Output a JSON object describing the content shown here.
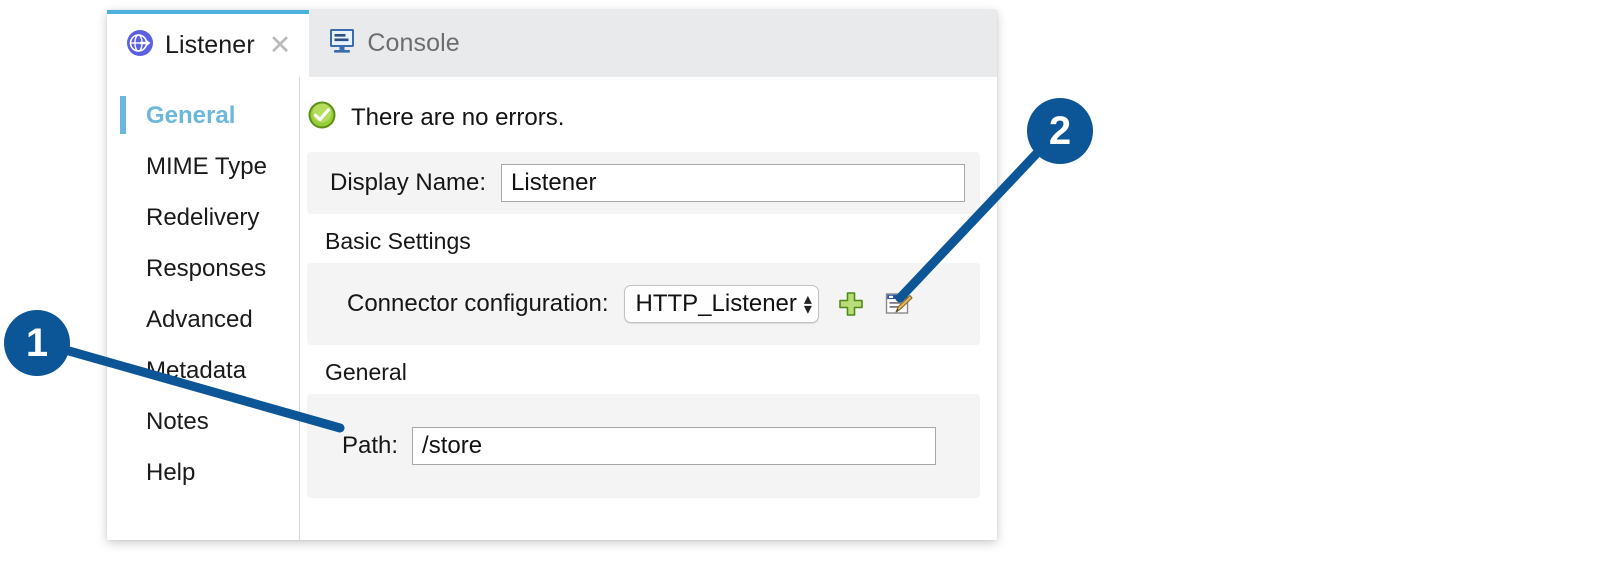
{
  "tabs": [
    {
      "label": "Listener",
      "icon": "globe-arrow-icon",
      "active": true,
      "closable": true,
      "close_glyph": "✕"
    },
    {
      "label": "Console",
      "icon": "monitor-icon",
      "active": false,
      "closable": false
    }
  ],
  "sidebar": {
    "items": [
      {
        "label": "General",
        "active": true
      },
      {
        "label": "MIME Type",
        "active": false
      },
      {
        "label": "Redelivery",
        "active": false
      },
      {
        "label": "Responses",
        "active": false
      },
      {
        "label": "Advanced",
        "active": false
      },
      {
        "label": "Metadata",
        "active": false
      },
      {
        "label": "Notes",
        "active": false
      },
      {
        "label": "Help",
        "active": false
      }
    ]
  },
  "content": {
    "status": {
      "icon": "success-check-icon",
      "text": "There are no errors."
    },
    "display_name": {
      "label": "Display Name:",
      "value": "Listener",
      "placeholder": ""
    },
    "basic_settings": {
      "section_title": "Basic Settings",
      "connector": {
        "label": "Connector configuration:",
        "selected": "HTTP_Listener",
        "options": [
          "HTTP_Listener"
        ],
        "chevron_up": "▴",
        "chevron_down": "▾",
        "add_button": {
          "name": "add-connector-button",
          "icon": "green-plus-icon"
        },
        "edit_button": {
          "name": "edit-connector-button",
          "icon": "edit-pencil-icon"
        }
      }
    },
    "general": {
      "section_title": "General",
      "path": {
        "label": "Path:",
        "value": "/store",
        "placeholder": ""
      }
    }
  },
  "callouts": [
    {
      "number": "1",
      "target": "path-field"
    },
    {
      "number": "2",
      "target": "add-connector-button"
    }
  ],
  "colors": {
    "callout_blue": "#0c5596",
    "active_tab_accent": "#4db1e0",
    "active_sidebar": "#6bb8dc",
    "success_green": "#7db52e",
    "tab_icon_purple": "#5a60e0"
  }
}
